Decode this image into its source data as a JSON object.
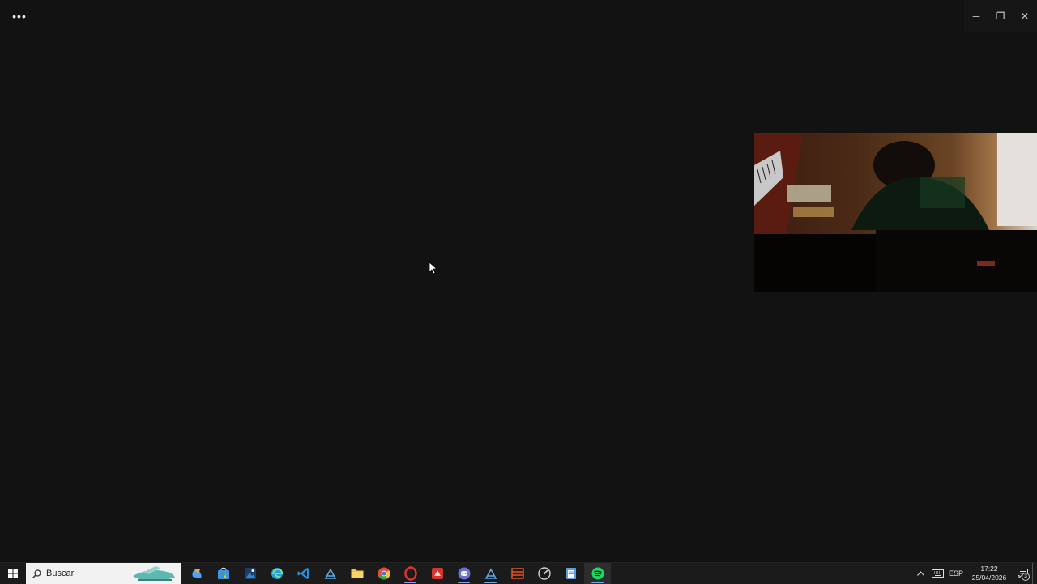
{
  "window": {
    "more_label": "•••",
    "minimize_label": "─",
    "restore_label": "❐",
    "close_label": "✕"
  },
  "taskbar": {
    "search_placeholder": "Buscar",
    "apps": [
      {
        "name": "copilot",
        "icon": "copilot-icon",
        "color": "#4aa3ff",
        "running": false
      },
      {
        "name": "microsoft-store",
        "icon": "store-icon",
        "color": "#3a96dd",
        "running": false
      },
      {
        "name": "photos",
        "icon": "photos-icon",
        "color": "#2b88d8",
        "running": false
      },
      {
        "name": "edge",
        "icon": "edge-icon",
        "color": "#1fa0d8",
        "running": false
      },
      {
        "name": "vs-code",
        "icon": "vscode-icon",
        "color": "#2a8fe0",
        "running": false
      },
      {
        "name": "steam",
        "icon": "steam-icon",
        "color": "#5aa7e0",
        "running": false
      },
      {
        "name": "file-explorer",
        "icon": "folder-icon",
        "color": "#f4c542",
        "running": false
      },
      {
        "name": "chrome",
        "icon": "chrome-icon",
        "color": "#e74c3c",
        "running": false
      },
      {
        "name": "opera",
        "icon": "opera-icon",
        "color": "#e0332f",
        "running": true
      },
      {
        "name": "capture-app",
        "icon": "red-app-icon",
        "color": "#d8332c",
        "running": false
      },
      {
        "name": "discord",
        "icon": "discord-icon",
        "color": "#6b6fe0",
        "running": true
      },
      {
        "name": "steam-2",
        "icon": "steam-icon",
        "color": "#5aa7e0",
        "running": true
      },
      {
        "name": "film-app",
        "icon": "film-icon",
        "color": "#e2572b",
        "running": false
      },
      {
        "name": "speedtest",
        "icon": "gauge-icon",
        "color": "#d0d0d0",
        "running": false
      },
      {
        "name": "notepad-app",
        "icon": "notepad-icon",
        "color": "#5aa0e6",
        "running": false
      },
      {
        "name": "spotify",
        "icon": "spotify-icon",
        "color": "#1ed760",
        "running": true
      }
    ],
    "tray": {
      "chevron": "^",
      "keyboard_icon": "keyboard-icon",
      "language": "ESP",
      "time": "17:22",
      "date": "25/04/2026",
      "notifications_count": "3"
    }
  }
}
